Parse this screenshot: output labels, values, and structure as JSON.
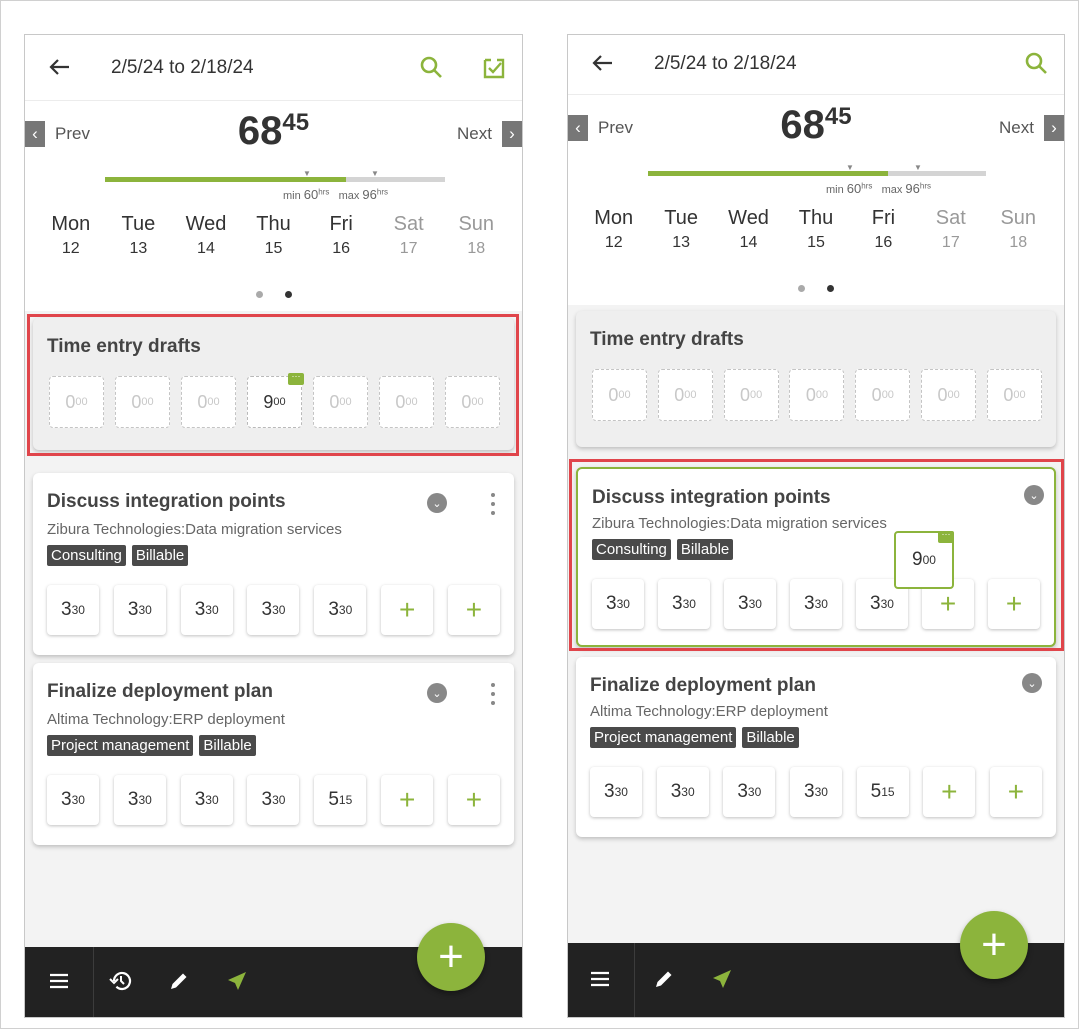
{
  "colors": {
    "accent": "#8cb43c",
    "highlight": "#e0454b",
    "tag_bg": "#4a4a4a",
    "bottombar": "#222222"
  },
  "icons": {
    "back": "arrow-left-icon",
    "search": "search-icon",
    "submit": "check-box-icon",
    "menu": "hamburger-menu-icon",
    "history": "history-icon",
    "edit": "pencil-icon",
    "send": "send-icon",
    "add": "plus-icon"
  },
  "header": {
    "title": "2/5/24 to 2/18/24"
  },
  "summary": {
    "prev_label": "Prev",
    "next_label": "Next",
    "total_hours": "68",
    "total_minutes": "45",
    "progress_fraction": 0.71,
    "min_label": "min",
    "min_value": "60",
    "max_label": "max",
    "max_value": "96",
    "hrs_unit": "hrs"
  },
  "days": [
    {
      "name": "Mon",
      "date": "12"
    },
    {
      "name": "Tue",
      "date": "13"
    },
    {
      "name": "Wed",
      "date": "14"
    },
    {
      "name": "Thu",
      "date": "15"
    },
    {
      "name": "Fri",
      "date": "16"
    },
    {
      "name": "Sat",
      "date": "17"
    },
    {
      "name": "Sun",
      "date": "18"
    }
  ],
  "drafts": {
    "title": "Time entry drafts",
    "left_slots": [
      {
        "h": "0",
        "m": "00"
      },
      {
        "h": "0",
        "m": "00"
      },
      {
        "h": "0",
        "m": "00"
      },
      {
        "h": "9",
        "m": "00"
      },
      {
        "h": "0",
        "m": "00"
      },
      {
        "h": "0",
        "m": "00"
      },
      {
        "h": "0",
        "m": "00"
      }
    ],
    "right_slots": [
      {
        "h": "0",
        "m": "00"
      },
      {
        "h": "0",
        "m": "00"
      },
      {
        "h": "0",
        "m": "00"
      },
      {
        "h": "0",
        "m": "00"
      },
      {
        "h": "0",
        "m": "00"
      },
      {
        "h": "0",
        "m": "00"
      },
      {
        "h": "0",
        "m": "00"
      }
    ]
  },
  "tasks": [
    {
      "title": "Discuss integration points",
      "subtitle": "Zibura Technologies:Data migration services",
      "tags": [
        "Consulting",
        "Billable"
      ],
      "hours": [
        {
          "h": "3",
          "m": "30"
        },
        {
          "h": "3",
          "m": "30"
        },
        {
          "h": "3",
          "m": "30"
        },
        {
          "h": "3",
          "m": "30"
        },
        {
          "h": "3",
          "m": "30"
        }
      ]
    },
    {
      "title": "Finalize deployment plan",
      "subtitle": "Altima Technology:ERP deployment",
      "tags": [
        "Project management",
        "Billable"
      ],
      "hours": [
        {
          "h": "3",
          "m": "30"
        },
        {
          "h": "3",
          "m": "30"
        },
        {
          "h": "3",
          "m": "30"
        },
        {
          "h": "3",
          "m": "30"
        },
        {
          "h": "5",
          "m": "15"
        }
      ]
    }
  ],
  "plus_label": "+",
  "fab_label": "+",
  "dragged": {
    "h": "9",
    "m": "00"
  }
}
